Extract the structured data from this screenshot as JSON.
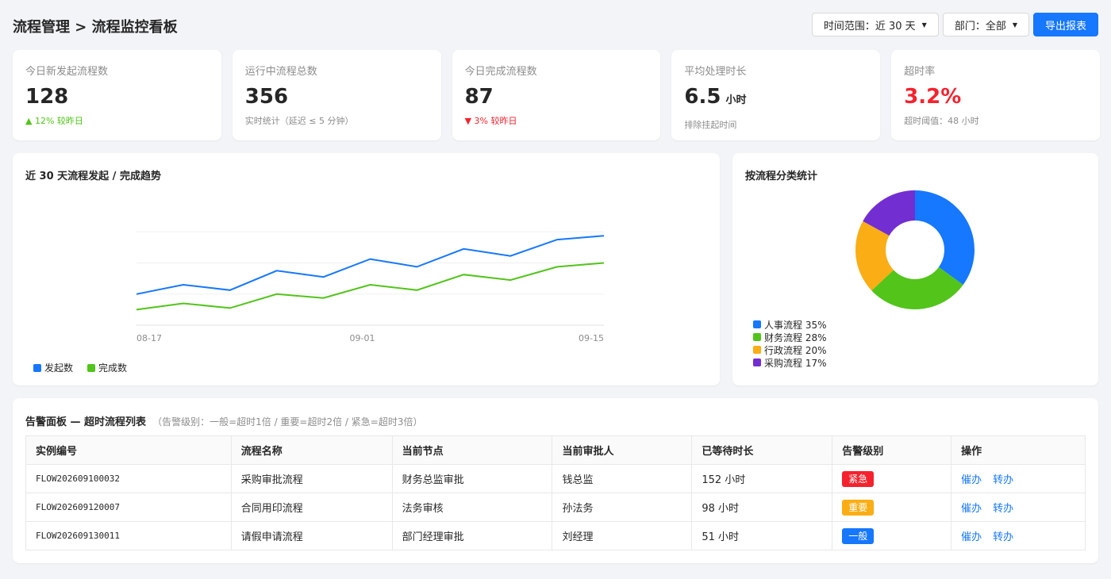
{
  "header": {
    "title": "流程管理 > 流程监控看板",
    "time_range_label": "时间范围：近 30 天",
    "department_label": "部门：全部",
    "export_label": "导出报表"
  },
  "kpis": [
    {
      "label": "今日新发起流程数",
      "value": "128",
      "unit": "",
      "sub": "▲ 12% 较昨日",
      "trend": "up"
    },
    {
      "label": "运行中流程总数",
      "value": "356",
      "unit": "",
      "sub": "实时统计（延迟 ≤ 5 分钟）",
      "trend": "neutral"
    },
    {
      "label": "今日完成流程数",
      "value": "87",
      "unit": "",
      "sub": "▼ 3% 较昨日",
      "trend": "down"
    },
    {
      "label": "平均处理时长",
      "value": "6.5",
      "unit": "小时",
      "sub": "排除挂起时间",
      "trend": "neutral"
    },
    {
      "label": "超时率",
      "value": "3.2%",
      "unit": "",
      "sub": "超时阈值：48 小时",
      "trend": "alert"
    }
  ],
  "trend_panel": {
    "title": "近 30 天流程发起 / 完成趋势"
  },
  "pie_panel": {
    "title": "按流程分类统计"
  },
  "chart_data": [
    {
      "type": "line",
      "title": "近 30 天流程发起 / 完成趋势",
      "x_ticks": [
        "08-17",
        "09-01",
        "09-15"
      ],
      "grid": true,
      "legend_position": "bottom-left",
      "series": [
        {
          "name": "发起数",
          "color": "#1677ff",
          "values": [
            40,
            52,
            45,
            70,
            62,
            85,
            75,
            98,
            89,
            110,
            115
          ]
        },
        {
          "name": "完成数",
          "color": "#52c41a",
          "values": [
            20,
            28,
            22,
            40,
            35,
            52,
            45,
            65,
            58,
            75,
            80
          ]
        }
      ]
    },
    {
      "type": "pie",
      "title": "按流程分类统计",
      "legend_position": "bottom-left",
      "slices": [
        {
          "label": "人事流程 35%",
          "value": 35,
          "color": "#1677ff"
        },
        {
          "label": "财务流程 28%",
          "value": 28,
          "color": "#52c41a"
        },
        {
          "label": "行政流程 20%",
          "value": 20,
          "color": "#faad14"
        },
        {
          "label": "采购流程 17%",
          "value": 17,
          "color": "#722ed1"
        }
      ]
    }
  ],
  "alerts": {
    "title": "告警面板 — 超时流程列表",
    "note": "（告警级别：一般=超时1倍 / 重要=超时2倍 / 紧急=超时3倍）",
    "columns": [
      "实例编号",
      "流程名称",
      "当前节点",
      "当前审批人",
      "已等待时长",
      "告警级别",
      "操作"
    ],
    "rows": [
      {
        "id": "FLOW202609100032",
        "name": "采购审批流程",
        "node": "财务总监审批",
        "approver": "钱总监",
        "wait": "152 小时",
        "level": "紧急",
        "level_color": "#f5222d",
        "action1": "催办",
        "action2": "转办"
      },
      {
        "id": "FLOW202609120007",
        "name": "合同用印流程",
        "node": "法务审核",
        "approver": "孙法务",
        "wait": "98 小时",
        "level": "重要",
        "level_color": "#faad14",
        "action1": "催办",
        "action2": "转办"
      },
      {
        "id": "FLOW202609130011",
        "name": "请假申请流程",
        "node": "部门经理审批",
        "approver": "刘经理",
        "wait": "51 小时",
        "level": "一般",
        "level_color": "#1677ff",
        "action1": "催办",
        "action2": "转办"
      }
    ]
  }
}
